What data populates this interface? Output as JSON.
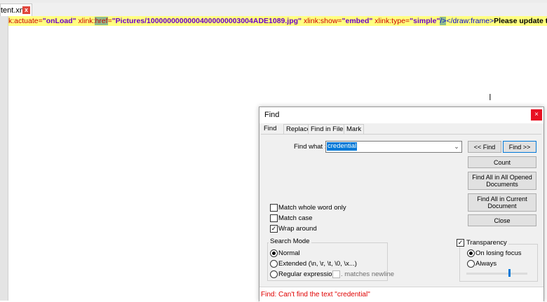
{
  "tab": {
    "filename": "tent.xml",
    "close_glyph": "x"
  },
  "code_line": {
    "a1": "k:actuate=",
    "v1": "\"onLoad\"",
    "a2": " xlink:",
    "a2hl": "href",
    "a2b": "=",
    "v2": "\"Pictures/10000000000004000000003004ADE1089.jpg\"",
    "a3": " xlink:show=",
    "v3": "\"embed\"",
    "a4": " xlink:type=",
    "v4": "\"simple\"",
    "t1hl": "/>",
    "t2": "</draw:frame>",
    "text": "Please update this file and se"
  },
  "dialog": {
    "title": "Find",
    "close_glyph": "×",
    "tabs": [
      "Find",
      "Replace",
      "Find in Files",
      "Mark"
    ],
    "find_what_label": "Find what :",
    "find_value": "credential",
    "buttons": {
      "prev": "<< Find",
      "next": "Find >>",
      "count": "Count",
      "find_all_opened": "Find All in All Opened Documents",
      "find_all_current": "Find All in Current Document",
      "close": "Close"
    },
    "options": {
      "whole_word": "Match whole word only",
      "match_case": "Match case",
      "wrap_around": "Wrap around"
    },
    "search_mode": {
      "title": "Search Mode",
      "normal": "Normal",
      "extended": "Extended (\\n, \\r, \\t, \\0, \\x...)",
      "regex": "Regular expression",
      "matches_newline": ". matches newline"
    },
    "transparency": {
      "title": "Transparency",
      "on_losing_focus": "On losing focus",
      "always": "Always",
      "level": 0.72
    },
    "status": "Find: Can't find the text \"credential\""
  },
  "colors": {
    "selection": "#0078d7",
    "status_error": "#e00000",
    "line_highlight": "#ffff80"
  }
}
